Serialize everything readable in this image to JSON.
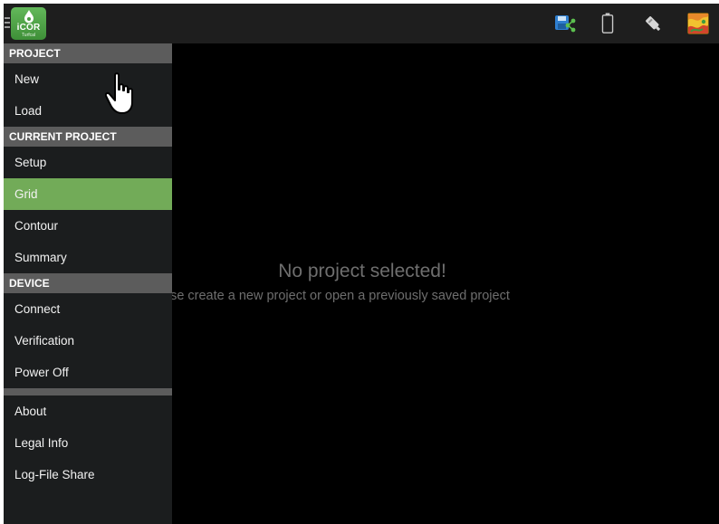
{
  "topbar": {
    "logo": {
      "brand": "iCOR",
      "sub": "Turfcal"
    },
    "icons": [
      "menu-icon",
      "save-share-icon",
      "battery-icon",
      "device-probe-icon",
      "map-icon"
    ]
  },
  "drawer": {
    "project_header": "PROJECT",
    "project_items": [
      "New",
      "Load"
    ],
    "current_header": "CURRENT PROJECT",
    "current_items": [
      "Setup",
      "Grid",
      "Contour",
      "Summary"
    ],
    "active_item": "Grid",
    "device_header": "DEVICE",
    "device_items": [
      "Connect",
      "Verification",
      "Power Off"
    ],
    "other_items": [
      "About",
      "Legal Info",
      "Log-File Share"
    ]
  },
  "content": {
    "empty_title": "No project selected!",
    "empty_message": "ase create a new project or open a previously saved project"
  },
  "colors": {
    "active": "#72ab58",
    "section": "#5c5c5c",
    "topbar": "#1e1e1e"
  }
}
